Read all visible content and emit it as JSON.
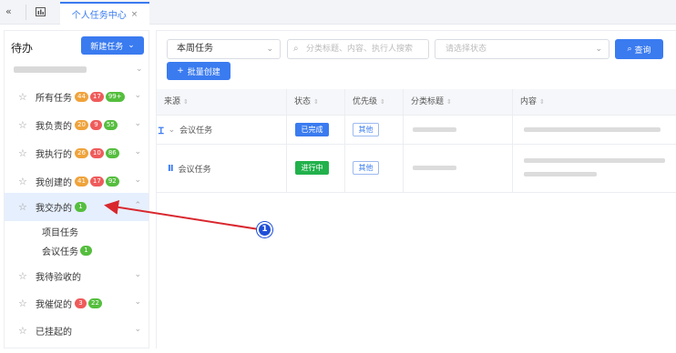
{
  "topbar": {
    "collapse_icon": "double-chevron-left-icon",
    "chart_icon": "chart-icon",
    "active_tab": "个人任务中心",
    "close_glyph": "×"
  },
  "sidebar": {
    "title": "待办",
    "new_task_label": "新建任务",
    "items": [
      {
        "label": "所有任务",
        "badges": [
          "44",
          "17",
          "99+"
        ],
        "colors": [
          "orange",
          "red",
          "green"
        ]
      },
      {
        "label": "我负责的",
        "badges": [
          "20",
          "9",
          "55"
        ],
        "colors": [
          "orange",
          "red",
          "green"
        ]
      },
      {
        "label": "我执行的",
        "badges": [
          "26",
          "10",
          "86"
        ],
        "colors": [
          "orange",
          "red",
          "green"
        ]
      },
      {
        "label": "我创建的",
        "badges": [
          "41",
          "17",
          "92"
        ],
        "colors": [
          "orange",
          "red",
          "green"
        ]
      },
      {
        "label": "我交办的",
        "badges": [
          "1"
        ],
        "colors": [
          "green"
        ],
        "active": true
      },
      {
        "label": "我待验收的",
        "badges": [],
        "colors": []
      },
      {
        "label": "我催促的",
        "badges": [
          "3",
          "22"
        ],
        "colors": [
          "red",
          "green"
        ]
      },
      {
        "label": "已挂起的",
        "badges": [],
        "colors": []
      }
    ],
    "sub_items": [
      {
        "label": "项目任务",
        "badge": ""
      },
      {
        "label": "会议任务",
        "badge": "1"
      }
    ]
  },
  "filters": {
    "period_value": "本周任务",
    "search_placeholder": "分类标题、内容、执行人搜索",
    "status_placeholder": "请选择状态",
    "query_label": "查询",
    "batch_create_label": "批量创建"
  },
  "table": {
    "headers": [
      "来源",
      "状态",
      "优先级",
      "分类标题",
      "内容"
    ],
    "rows": [
      {
        "source": "会议任务",
        "status": "已完成",
        "status_type": "done",
        "priority": "其他"
      },
      {
        "source": "会议任务",
        "status": "进行中",
        "status_type": "doing",
        "priority": "其他"
      }
    ]
  },
  "annotation": {
    "number": "1",
    "color": "#d9272e"
  },
  "colors": {
    "accent": "#3a7bf0",
    "badge_orange": "#f0a33b",
    "badge_red": "#ef5b5b",
    "badge_green": "#55be3e"
  }
}
